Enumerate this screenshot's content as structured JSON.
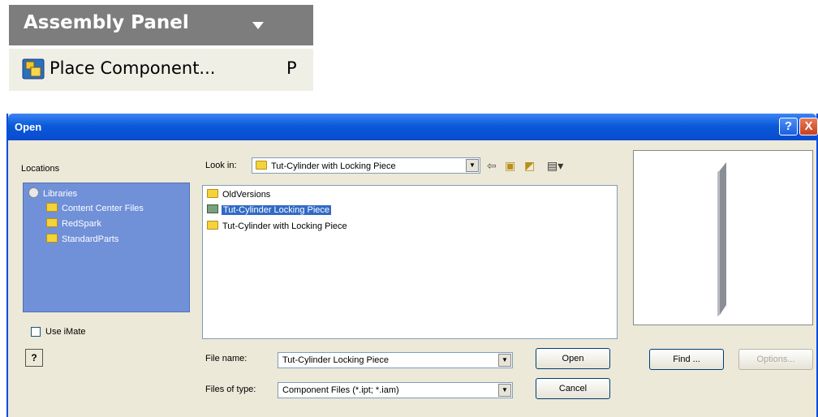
{
  "assembly_panel": {
    "title": "Assembly Panel",
    "caret_icon": "triangle-down-icon",
    "place_component_label": "Place Component...",
    "place_component_shortcut": "P",
    "place_component_icon": "place-component-icon"
  },
  "dialog": {
    "title": "Open",
    "help_icon": "?",
    "close_icon": "X",
    "locations_label": "Locations",
    "locations": [
      {
        "label": "Libraries",
        "icon": "library-icon"
      },
      {
        "label": "Content Center Files",
        "icon": "folder-icon"
      },
      {
        "label": "RedSpark",
        "icon": "folder-icon"
      },
      {
        "label": "StandardParts",
        "icon": "folder-icon"
      }
    ],
    "use_imate_label": "Use iMate",
    "help_button_label": "?",
    "look_in_label": "Look in:",
    "look_in_value": "Tut-Cylinder with Locking Piece",
    "toolbar_icons": [
      "back-arrow-icon",
      "up-folder-icon",
      "new-folder-icon",
      "view-menu-icon"
    ],
    "files": [
      {
        "name": "OldVersions",
        "icon": "folder-icon",
        "selected": false
      },
      {
        "name": "Tut-Cylinder Locking Piece",
        "icon": "part-file-icon",
        "selected": true
      },
      {
        "name": "Tut-Cylinder with Locking Piece",
        "icon": "folder-icon",
        "selected": false
      }
    ],
    "file_name_label": "File name:",
    "file_name_value": "Tut-Cylinder Locking Piece",
    "files_of_type_label": "Files of type:",
    "files_of_type_value": "Component Files (*.ipt; *.iam)",
    "open_label": "Open",
    "cancel_label": "Cancel",
    "find_label": "Find ...",
    "options_label": "Options..."
  }
}
